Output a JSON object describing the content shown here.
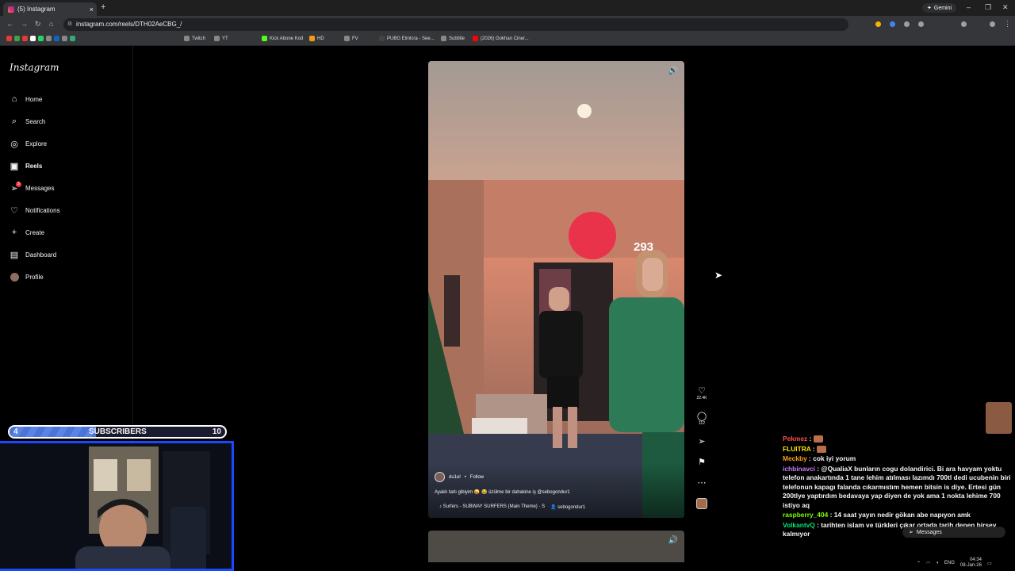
{
  "browser": {
    "tab_title": "(5) Instagram",
    "url": "instagram.com/reels/DTH02AeCBG_/",
    "gemini_label": "Gemini",
    "bookmarks": [
      {
        "label": "Twitch",
        "color": "#9146ff"
      },
      {
        "label": "YT",
        "color": "#ff0000"
      },
      {
        "label": "Kick Abone Kod",
        "color": "#53fc18"
      },
      {
        "label": "HD",
        "color": "#f39c12"
      },
      {
        "label": "FV",
        "color": "#777777"
      },
      {
        "label": "PUBG Elmlcra - See...",
        "color": "#444444"
      },
      {
        "label": "Subtitle",
        "color": "#777777"
      },
      {
        "label": "(2026) Gokhan Ciner...",
        "color": "#ff0000"
      }
    ]
  },
  "sidebar": {
    "logo": "Instagram",
    "items": [
      {
        "label": "Home",
        "icon": "home-icon"
      },
      {
        "label": "Search",
        "icon": "search-icon"
      },
      {
        "label": "Explore",
        "icon": "explore-icon"
      },
      {
        "label": "Reels",
        "icon": "reels-icon",
        "active": true
      },
      {
        "label": "Messages",
        "icon": "messages-icon",
        "badge": "5"
      },
      {
        "label": "Notifications",
        "icon": "heart-icon"
      },
      {
        "label": "Create",
        "icon": "plus-icon"
      },
      {
        "label": "Dashboard",
        "icon": "dashboard-icon"
      },
      {
        "label": "Profile",
        "icon": "avatar"
      }
    ]
  },
  "reel": {
    "overlay_count": "293",
    "author": "du1el",
    "follow_label": "Follow",
    "caption": "Ayaklı tarlı gibiyim 😜 😂 üzülme bir dahakine iş @sebogondur1",
    "audio": "♪ Surfers - SUBWAY SURFERS (Main Theme) · S",
    "audio_user": "sebogondur1",
    "likes": "22.4K",
    "comments": "112"
  },
  "subscribers": {
    "current": "4",
    "label": "SUBSCRIBERS",
    "goal": "10",
    "progress": 0.4
  },
  "chat": [
    {
      "user": "Pekmez",
      "color": "#ff4d4d",
      "text": ""
    },
    {
      "user": "FLUITRA",
      "color": "#ffe600",
      "text": ""
    },
    {
      "user": "Meckby",
      "color": "#ff9f1c",
      "text": "cok iyi yorum"
    },
    {
      "user": "ichbinavci",
      "color": "#c77dff",
      "text": "@QualiaX bunların cogu dolandirici. Bi ara havyam yoktu telefon anakartında 1 tane lehim atılması lazımdı 700tl dedi ucubenin biri telefonun kapagı falanda cıkarmıstım hemen bitsin is diye. Ertesi gün 200tlye yaptırdım bedavaya yap diyen de yok ama 1 nokta lehime 700 istiyo aq"
    },
    {
      "user": "raspberry_404",
      "color": "#7fff00",
      "text": "14 saat yayın nedir gökan abe napıyon amk"
    },
    {
      "user": "VolkantvQ",
      "color": "#00e676",
      "text": "tarihten islam ve türkleri çıkar ortada tarih denen birşey kalmıyor"
    }
  ],
  "floating_messages_label": "Messages",
  "taskbar": {
    "lang": "ENG",
    "time": "04:34",
    "date": "08-Jan-26"
  }
}
